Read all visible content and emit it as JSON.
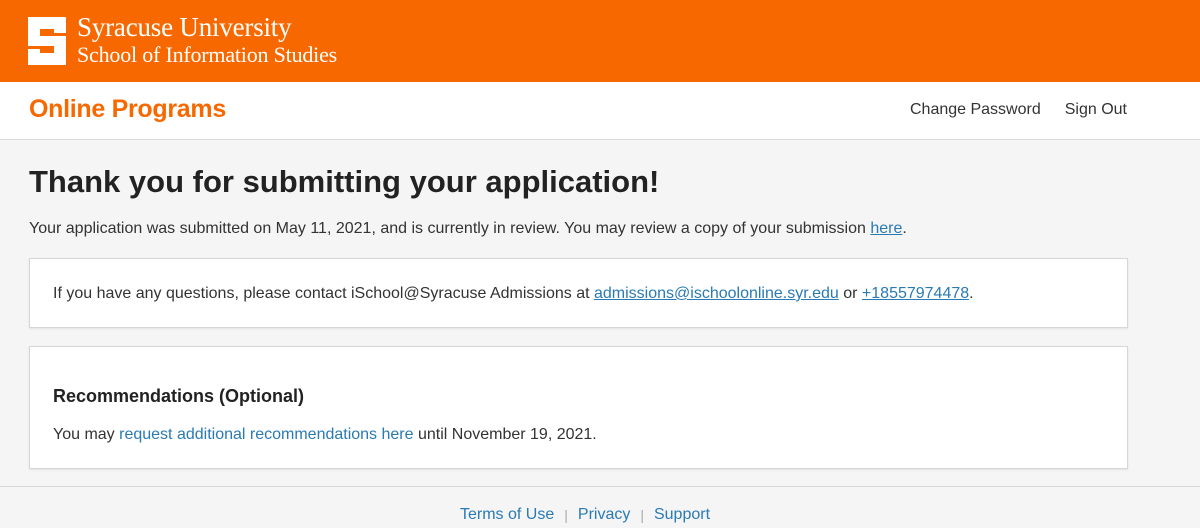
{
  "brand": {
    "logo_icon": "orange-block-s-logo",
    "university": "Syracuse University",
    "school": "School of Information Studies",
    "color": "#f76900"
  },
  "nav": {
    "title": "Online Programs",
    "change_password": "Change Password",
    "sign_out": "Sign Out"
  },
  "main": {
    "title": "Thank you for submitting your application!",
    "intro_text": "Your application was submitted on May 11, 2021, and is currently in review. You may review a copy of your submission ",
    "intro_link": "here",
    "intro_end": ".",
    "contact": {
      "text": "If you have any questions, please contact iSchool@Syracuse Admissions at ",
      "email": "admissions@ischoolonline.syr.edu",
      "or": " or ",
      "phone": "+18557974478",
      "end": "."
    },
    "recommendations": {
      "heading": "Recommendations (Optional)",
      "prefix": "You may ",
      "link": "request additional recommendations here",
      "suffix": " until November 19, 2021."
    }
  },
  "footer": {
    "terms": "Terms of Use",
    "privacy": "Privacy",
    "support": "Support",
    "separator": "|"
  },
  "colors": {
    "accent": "#f76900",
    "link": "#2a7ab3"
  }
}
